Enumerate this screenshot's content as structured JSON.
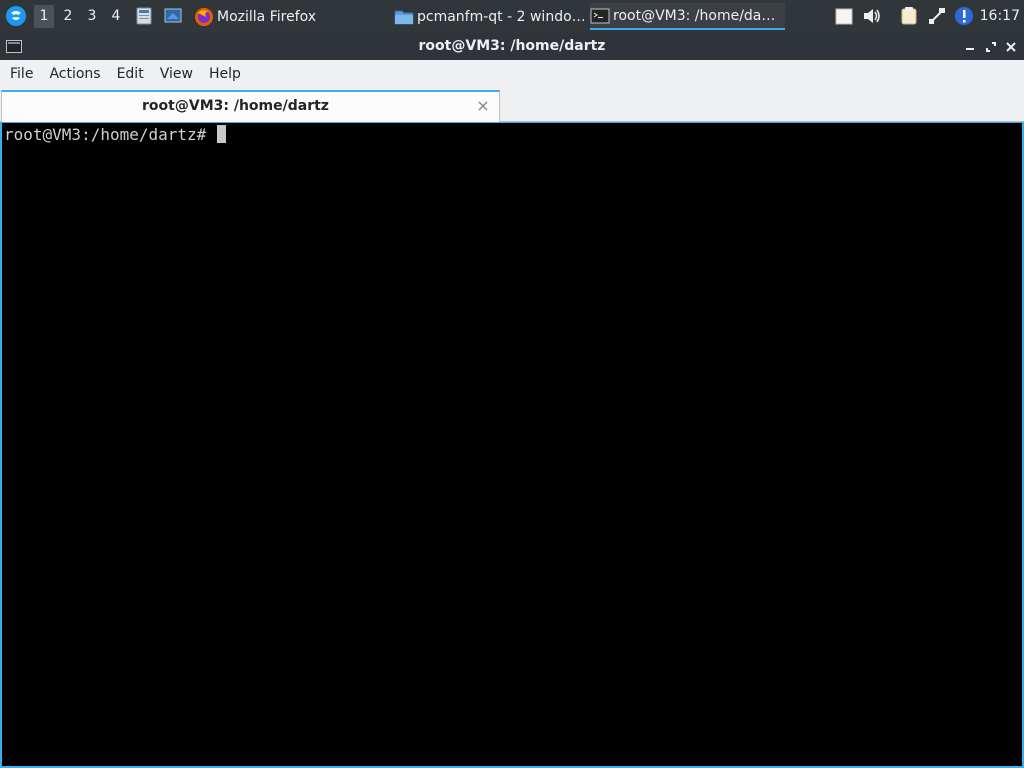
{
  "taskbar": {
    "desktops": [
      "1",
      "2",
      "3",
      "4"
    ],
    "active_desktop": "1",
    "tasks": [
      {
        "label": "Mozilla Firefox",
        "icon": "firefox-icon"
      },
      {
        "label": "pcmanfm-qt - 2 windo…",
        "icon": "folder-icon"
      },
      {
        "label": "root@VM3: /home/da…",
        "icon": "terminal-icon",
        "active": true
      }
    ],
    "clock": "16:17"
  },
  "window": {
    "title": "root@VM3: /home/dartz"
  },
  "menu": {
    "file": "File",
    "actions": "Actions",
    "edit": "Edit",
    "view": "View",
    "help": "Help"
  },
  "tabs": [
    {
      "label": "root@VM3: /home/dartz"
    }
  ],
  "terminal": {
    "prompt": "root@VM3:/home/dartz# "
  },
  "colors": {
    "panel_bg": "#31363b",
    "accent": "#3daee9",
    "menu_bg": "#eff0f1",
    "terminal_bg": "#000000"
  }
}
